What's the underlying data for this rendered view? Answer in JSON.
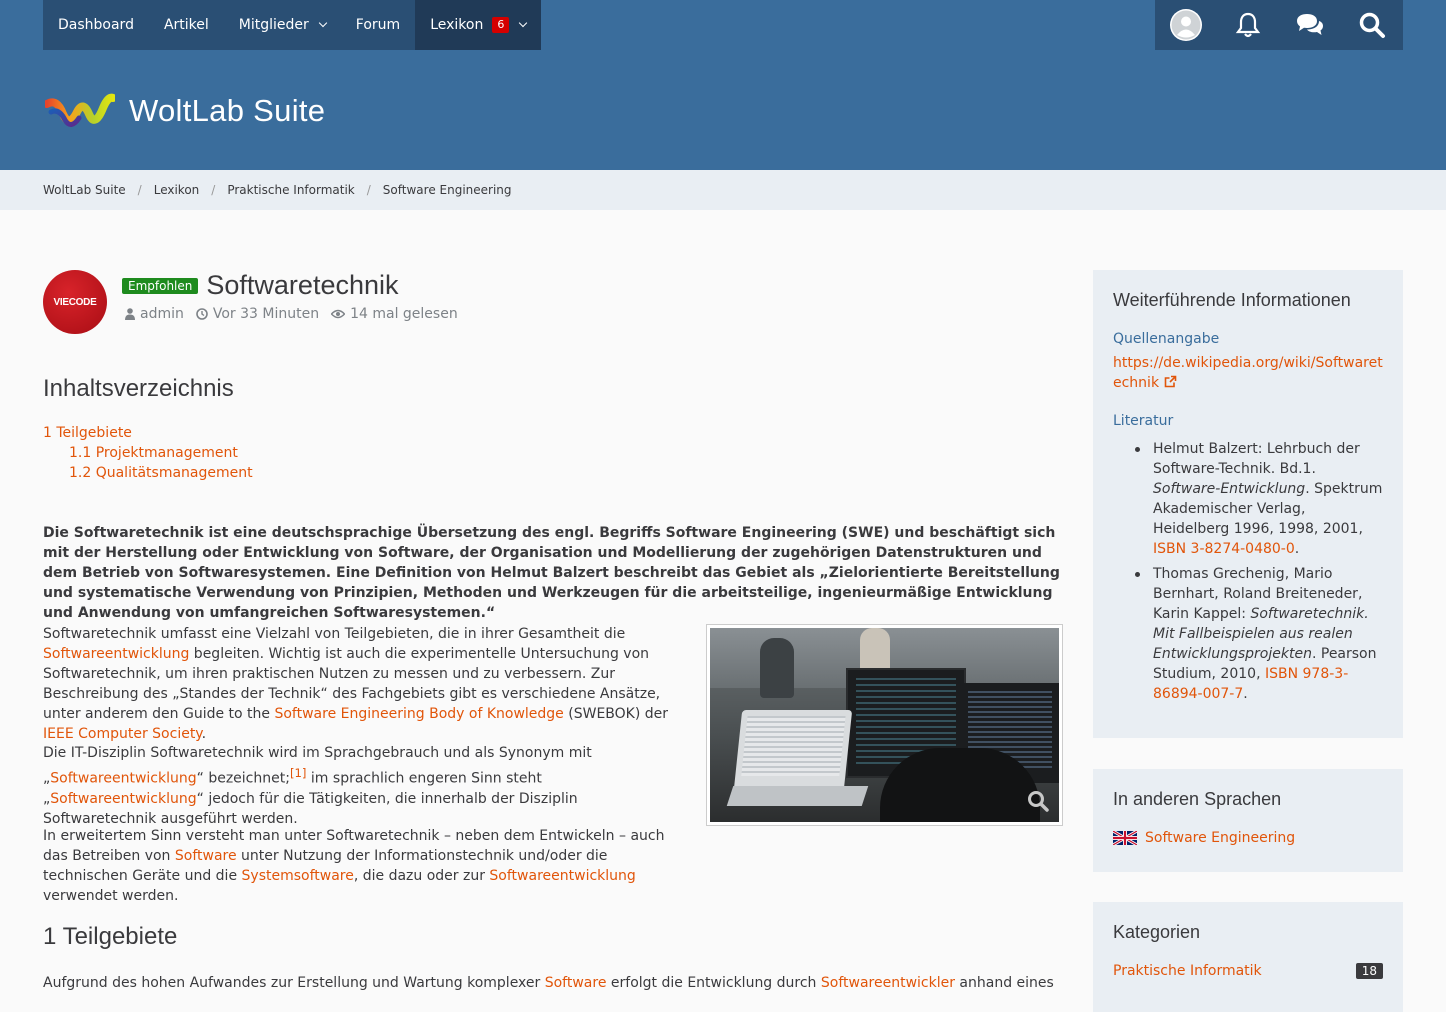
{
  "nav": {
    "items": [
      {
        "label": "Dashboard"
      },
      {
        "label": "Artikel"
      },
      {
        "label": "Mitglieder"
      },
      {
        "label": "Forum"
      },
      {
        "label": "Lexikon",
        "badge": "6"
      }
    ]
  },
  "header": {
    "logo_text": "WoltLab Suite"
  },
  "breadcrumb": [
    "WoltLab Suite",
    "Lexikon",
    "Praktische Informatik",
    "Software Engineering"
  ],
  "article": {
    "avatar_text": "VIECODE",
    "badge": "Empfohlen",
    "title": "Softwaretechnik",
    "author": "admin",
    "time": "Vor 33 Minuten",
    "views": "14 mal gelesen",
    "toc_title": "Inhaltsverzeichnis",
    "toc": [
      "1 Teilgebiete",
      "1.1 Projektmanagement",
      "1.2 Qualitätsmanagement"
    ],
    "lead": "Die Softwaretechnik ist eine deutschsprachige Übersetzung des engl. Begriffs Software Engineering (SWE) und beschäftigt sich mit der Herstellung oder Entwicklung von Software, der Organisation und Modellierung der zugehörigen Datenstrukturen und dem Betrieb von Softwaresystemen. Eine Definition von Helmut Balzert beschreibt das Gebiet als „Zielorientierte Bereitstellung und systematische Verwendung von Prinzipien, Methoden und Werkzeugen für die arbeitsteilige, ingenieurmäßige Entwicklung und Anwendung von umfangreichen Softwaresystemen.“",
    "p1": {
      "a": "Softwaretechnik umfasst eine Vielzahl von Teilgebieten, die in ihrer Gesamtheit die ",
      "l1": "Softwareentwicklung",
      "b": " begleiten. Wichtig ist auch die experimentelle Untersuchung von Softwaretechnik, um ihren praktischen Nutzen zu messen und zu verbessern. Zur Beschreibung des „Standes der Technik“ des Fachgebiets gibt es verschiedene Ansätze, unter anderem den Guide to the ",
      "l2": "Software Engineering Body of Knowledge",
      "c": " (SWEBOK) der ",
      "l3": "IEEE Computer Society",
      "d": "."
    },
    "p2": {
      "a": "Die IT-Disziplin Softwaretechnik wird im Sprachgebrauch und als Synonym mit „",
      "l1": "Softwareentwicklung",
      "b": "“ bezeichnet;",
      "ref": "[1]",
      "c": " im sprachlich engeren Sinn steht „",
      "l2": "Softwareentwicklung",
      "d": "“ jedoch für die Tätigkeiten, die innerhalb der Disziplin Softwaretechnik ausgeführt werden."
    },
    "p3": {
      "a": "In erweitertem Sinn versteht man unter Softwaretechnik – neben dem Entwickeln – auch das Betreiben von ",
      "l1": "Software",
      "b": " unter Nutzung der Informationstechnik und/oder die technischen Geräte und die ",
      "l2": "Systemsoftware",
      "c": ", die dazu oder zur ",
      "l3": "Softwareentwicklung",
      "d": " verwendet werden."
    },
    "h2": "1 Teilgebiete",
    "p4": {
      "a": "Aufgrund des hohen Aufwandes zur Erstellung und Wartung komplexer ",
      "l1": "Software",
      "b": " erfolgt die Entwicklung durch ",
      "l2": "Softwareentwickler",
      "c": " anhand eines"
    }
  },
  "sidebar": {
    "info": {
      "title": "Weiterführende Informationen",
      "source_label": "Quellenangabe",
      "source_link": "https://de.wikipedia.org/wiki/Softwaretechnik",
      "lit_label": "Literatur",
      "lit1": {
        "a": "Helmut Balzert: Lehrbuch der Software-Technik. Bd.1. ",
        "i": "Software-Entwicklung",
        "b": ". Spektrum Akademischer Verlag, Heidelberg 1996, 1998, 2001, ",
        "l": "ISBN 3-8274-0480-0",
        "c": "."
      },
      "lit2": {
        "a": "Thomas Grechenig, Mario Bernhart, Roland Breiteneder, Karin Kappel: ",
        "i": "Softwaretechnik. Mit Fallbeispielen aus realen Entwicklungsprojekten",
        "b": ". Pearson Studium, 2010, ",
        "l": "ISBN 978-3-86894-007-7",
        "c": "."
      }
    },
    "lang": {
      "title": "In anderen Sprachen",
      "item": "Software Engineering"
    },
    "cats": {
      "title": "Kategorien",
      "item": "Praktische Informatik",
      "count": "18"
    }
  }
}
